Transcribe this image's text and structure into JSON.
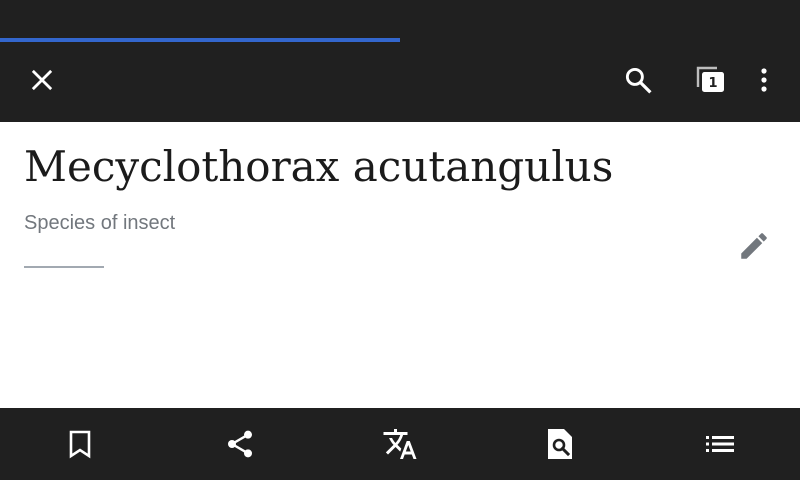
{
  "page_load_progress": 0.5,
  "toolbar": {
    "close_icon": "close-icon",
    "search_icon": "search-icon",
    "tabs_icon": "tabs-icon",
    "tab_count": "1",
    "overflow_icon": "more-vert-icon"
  },
  "article": {
    "title": "Mecyclothorax acutangulus",
    "description": "Species of insect",
    "edit_icon": "pencil-icon"
  },
  "bottom_toolbar": {
    "items": [
      "bookmark-icon",
      "share-icon",
      "translate-icon",
      "find-in-page-icon",
      "contents-list-icon"
    ]
  },
  "colors": {
    "bar_background": "#202020",
    "progress": "#3366cc",
    "icon": "#ffffff",
    "title_text": "#1b1b1b",
    "description_text": "#72777d"
  }
}
